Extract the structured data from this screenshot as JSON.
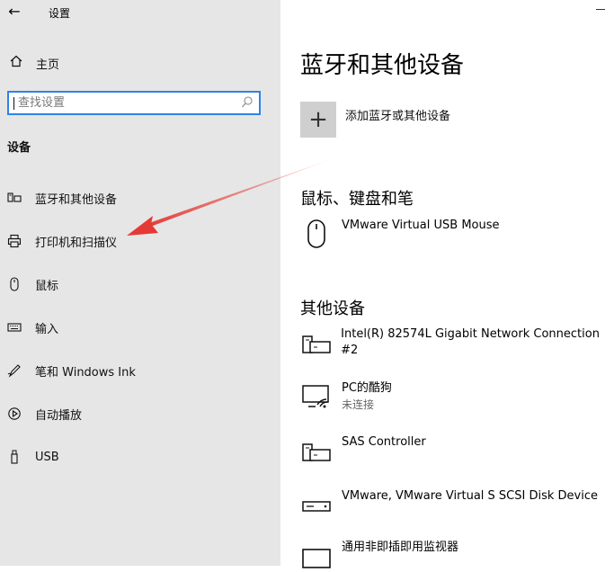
{
  "window": {
    "title": "设置",
    "back_label": "←"
  },
  "sidebar": {
    "home_label": "主页",
    "search": {
      "placeholder": "查找设置"
    },
    "section_header": "设备",
    "items": [
      {
        "label": "蓝牙和其他设备",
        "icon": "bluetooth-devices-icon"
      },
      {
        "label": "打印机和扫描仪",
        "icon": "printer-icon"
      },
      {
        "label": "鼠标",
        "icon": "mouse-icon"
      },
      {
        "label": "输入",
        "icon": "keyboard-icon"
      },
      {
        "label": "笔和 Windows Ink",
        "icon": "pen-icon"
      },
      {
        "label": "自动播放",
        "icon": "autoplay-icon"
      },
      {
        "label": "USB",
        "icon": "usb-icon"
      }
    ]
  },
  "main": {
    "title": "蓝牙和其他设备",
    "add_device_label": "添加蓝牙或其他设备",
    "mouse_section": {
      "title": "鼠标、键盘和笔",
      "devices": [
        {
          "name": "VMware Virtual USB Mouse",
          "icon": "mouse-icon"
        }
      ]
    },
    "other_section": {
      "title": "其他设备",
      "devices": [
        {
          "name": "Intel(R) 82574L Gigabit Network Connection #2",
          "status": "",
          "icon": "network-device-icon"
        },
        {
          "name": "PC的酷狗",
          "status": "未连接",
          "icon": "media-device-icon"
        },
        {
          "name": "SAS Controller",
          "status": "",
          "icon": "generic-device-icon"
        },
        {
          "name": "VMware, VMware Virtual S SCSI Disk Device",
          "status": "",
          "icon": "disk-device-icon"
        },
        {
          "name": "通用非即插即用监视器",
          "status": "",
          "icon": "monitor-icon"
        }
      ]
    }
  },
  "colors": {
    "accent": "#2f83e8",
    "sidebar_bg": "#e6e6e6",
    "annotation": "#e53935"
  }
}
